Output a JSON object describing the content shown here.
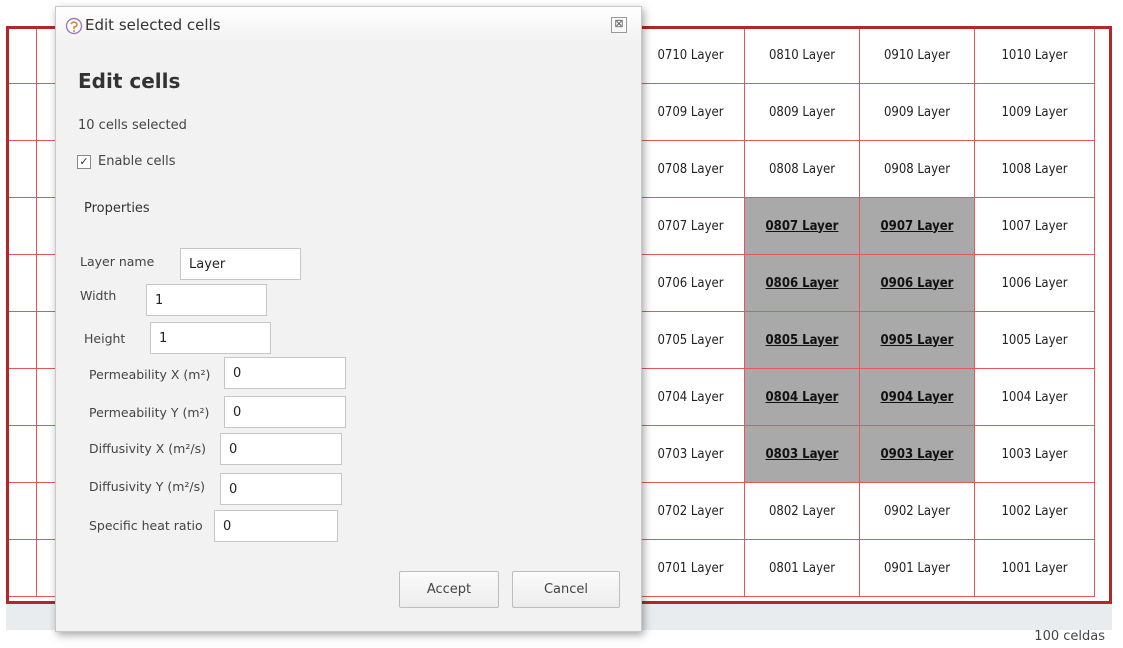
{
  "grid": {
    "rows": [
      [
        "",
        "",
        "",
        "",
        "",
        "",
        "",
        "0710 Layer",
        "0810 Layer",
        "0910 Layer",
        "1010 Layer"
      ],
      [
        "",
        "",
        "",
        "",
        "",
        "",
        "",
        "0709 Layer",
        "0809 Layer",
        "0909 Layer",
        "1009 Layer"
      ],
      [
        "",
        "",
        "",
        "",
        "",
        "",
        "",
        "0708 Layer",
        "0808 Layer",
        "0908 Layer",
        "1008 Layer"
      ],
      [
        "",
        "",
        "",
        "",
        "",
        "",
        "",
        "0707 Layer",
        "0807 Layer",
        "0907 Layer",
        "1007 Layer"
      ],
      [
        "",
        "",
        "",
        "",
        "",
        "",
        "",
        "0706 Layer",
        "0806 Layer",
        "0906 Layer",
        "1006 Layer"
      ],
      [
        "",
        "",
        "",
        "",
        "",
        "",
        "",
        "0705 Layer",
        "0805 Layer",
        "0905 Layer",
        "1005 Layer"
      ],
      [
        "",
        "",
        "",
        "",
        "",
        "",
        "",
        "0704 Layer",
        "0804 Layer",
        "0904 Layer",
        "1004 Layer"
      ],
      [
        "",
        "",
        "",
        "",
        "",
        "",
        "",
        "0703 Layer",
        "0803 Layer",
        "0903 Layer",
        "1003 Layer"
      ],
      [
        "",
        "",
        "",
        "",
        "",
        "",
        "",
        "0702 Layer",
        "0802 Layer",
        "0902 Layer",
        "1002 Layer"
      ],
      [
        "",
        "",
        "",
        "",
        "",
        "",
        "",
        "0701 Layer",
        "0801 Layer",
        "0901 Layer",
        "1001 Layer"
      ]
    ],
    "selected": [
      "0807 Layer",
      "0907 Layer",
      "0806 Layer",
      "0906 Layer",
      "0805 Layer",
      "0905 Layer",
      "0804 Layer",
      "0904 Layer",
      "0803 Layer",
      "0903 Layer"
    ],
    "count_label": "100 celdas"
  },
  "dialog": {
    "title": "Edit selected cells",
    "close_glyph": "⊠",
    "heading": "Edit cells",
    "selection_summary": "10 cells selected",
    "enable_label": "Enable cells",
    "enable_checked": true,
    "check_glyph": "✓",
    "section_label": "Properties",
    "fields": {
      "layer_name": {
        "label": "Layer name",
        "value": "Layer"
      },
      "width": {
        "label": "Width",
        "value": "1"
      },
      "height": {
        "label": "Height",
        "value": "1"
      },
      "permeability_x": {
        "label": "Permeability X (m²)",
        "value": "0"
      },
      "permeability_y": {
        "label": "Permeability Y (m²)",
        "value": "0"
      },
      "diffusivity_x": {
        "label": "Diffusivity X (m²/s)",
        "value": "0"
      },
      "diffusivity_y": {
        "label": "Diffusivity Y (m²/s)",
        "value": "0"
      },
      "specific_heat": {
        "label": "Specific heat ratio",
        "value": "0"
      }
    },
    "accept_label": "Accept",
    "cancel_label": "Cancel"
  },
  "colors": {
    "grid_border": "#b3262a",
    "grid_line": "#e6575c",
    "selected_fill": "#a9a9a9",
    "dialog_bg": "#f2f2f2"
  }
}
